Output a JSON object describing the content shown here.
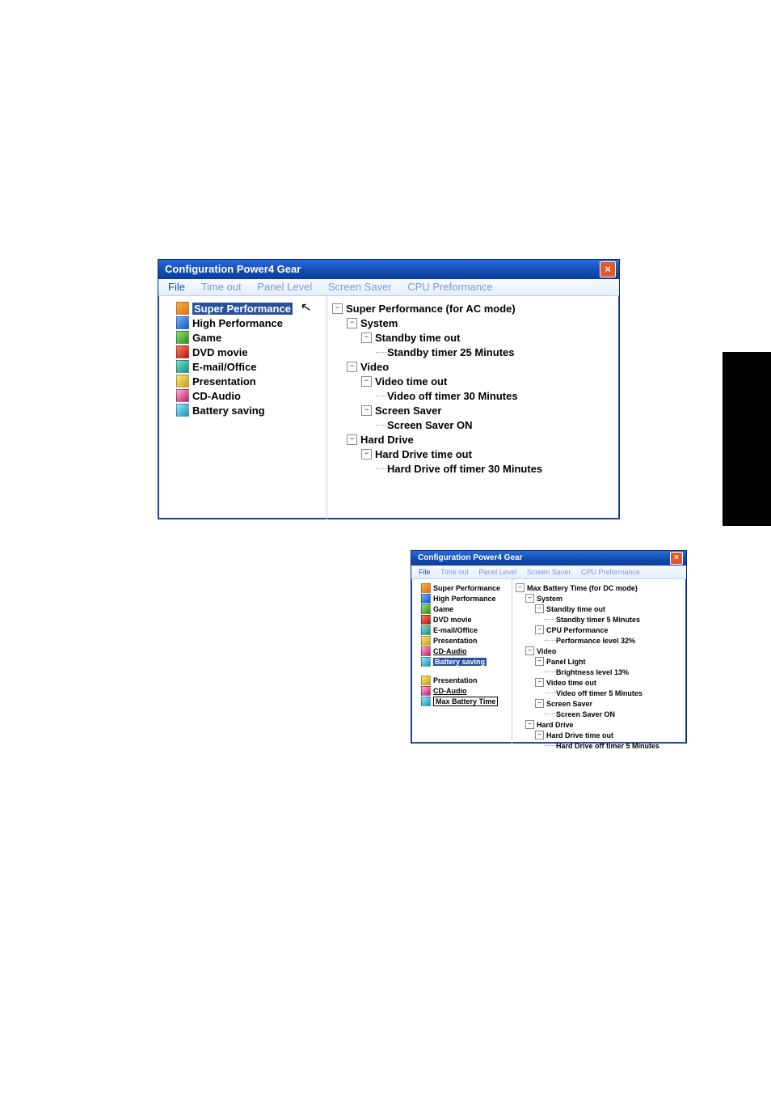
{
  "win1": {
    "title": "Configuration Power4 Gear",
    "menu": [
      "File",
      "Time out",
      "Panel Level",
      "Screen Saver",
      "CPU Preformance"
    ],
    "menu_active": 0,
    "presets": [
      {
        "label": "Super Performance",
        "icon": "orange",
        "selected": true
      },
      {
        "label": "High Performance",
        "icon": "blue"
      },
      {
        "label": "Game",
        "icon": "green"
      },
      {
        "label": "DVD movie",
        "icon": "red"
      },
      {
        "label": "E-mail/Office",
        "icon": "teal"
      },
      {
        "label": "Presentation",
        "icon": "yellow"
      },
      {
        "label": "CD-Audio",
        "icon": "pink"
      },
      {
        "label": "Battery saving",
        "icon": "cyan"
      }
    ],
    "tree": [
      {
        "d": 0,
        "exp": "-",
        "label": "Super Performance (for AC mode)"
      },
      {
        "d": 1,
        "exp": "-",
        "label": "System"
      },
      {
        "d": 2,
        "exp": "-",
        "label": "Standby time out"
      },
      {
        "d": 3,
        "label": "Standby timer 25 Minutes"
      },
      {
        "d": 1,
        "exp": "-",
        "label": "Video"
      },
      {
        "d": 2,
        "exp": "-",
        "label": "Video time out"
      },
      {
        "d": 3,
        "label": "Video off timer 30 Minutes"
      },
      {
        "d": 2,
        "exp": "-",
        "label": "Screen Saver"
      },
      {
        "d": 3,
        "label": "Screen Saver ON"
      },
      {
        "d": 1,
        "exp": "-",
        "label": "Hard Drive"
      },
      {
        "d": 2,
        "exp": "-",
        "label": "Hard Drive time out"
      },
      {
        "d": 3,
        "label": "Hard Drive off timer 30 Minutes"
      }
    ]
  },
  "win2": {
    "title": "Configuration Power4 Gear",
    "menu": [
      "File",
      "Time out",
      "Panel Level",
      "Screen Saver",
      "CPU Preformance"
    ],
    "menu_active": 0,
    "presets": [
      {
        "label": "Super Performance",
        "icon": "orange"
      },
      {
        "label": "High Performance",
        "icon": "blue"
      },
      {
        "label": "Game",
        "icon": "green"
      },
      {
        "label": "DVD movie",
        "icon": "red"
      },
      {
        "label": "E-mail/Office",
        "icon": "teal"
      },
      {
        "label": "Presentation",
        "icon": "yellow"
      },
      {
        "label": "CD-Audio",
        "icon": "pink",
        "underline": true
      },
      {
        "label": "Battery saving",
        "icon": "cyan",
        "selected": true
      }
    ],
    "presets2": [
      {
        "label": "Presentation",
        "icon": "yellow"
      },
      {
        "label": "CD-Audio",
        "icon": "pink",
        "underline": true
      },
      {
        "label": "Max Battery Time",
        "icon": "cyan",
        "boxed": true
      }
    ],
    "tree": [
      {
        "d": 0,
        "exp": "-",
        "label": "Max Battery Time (for DC mode)"
      },
      {
        "d": 1,
        "exp": "-",
        "label": "System"
      },
      {
        "d": 2,
        "exp": "-",
        "label": "Standby time out"
      },
      {
        "d": 3,
        "label": "Standby timer 5 Minutes"
      },
      {
        "d": 2,
        "exp": "-",
        "label": "CPU Performance"
      },
      {
        "d": 3,
        "label": "Performance level 32%"
      },
      {
        "d": 1,
        "exp": "-",
        "label": "Video"
      },
      {
        "d": 2,
        "exp": "-",
        "label": "Panel Light"
      },
      {
        "d": 3,
        "label": "Brightness level 13%"
      },
      {
        "d": 2,
        "exp": "-",
        "label": "Video time out"
      },
      {
        "d": 3,
        "label": "Video off timer 5 Minutes"
      },
      {
        "d": 2,
        "exp": "-",
        "label": "Screen Saver"
      },
      {
        "d": 3,
        "label": "Screen Saver ON"
      },
      {
        "d": 1,
        "exp": "-",
        "label": "Hard Drive"
      },
      {
        "d": 2,
        "exp": "-",
        "label": "Hard Drive time out"
      },
      {
        "d": 3,
        "label": "Hard Drive off timer 5 Minutes"
      }
    ]
  },
  "close_glyph": "×"
}
